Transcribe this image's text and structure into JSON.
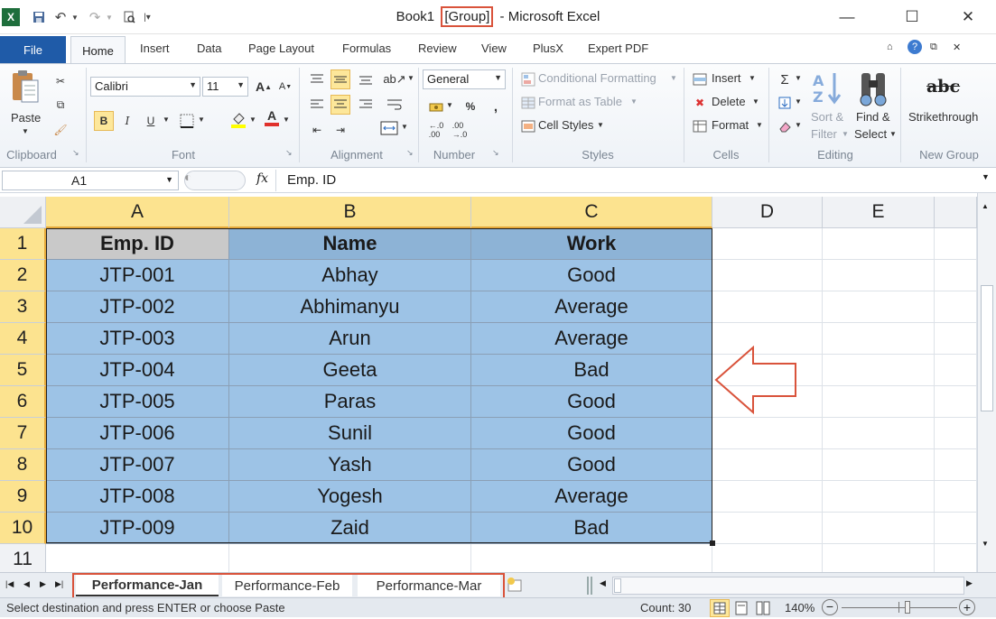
{
  "title": {
    "prefix": "Book1",
    "group": "[Group]",
    "suffix": "- Microsoft Excel"
  },
  "tabs": [
    "File",
    "Home",
    "Insert",
    "Data",
    "Page Layout",
    "Formulas",
    "Review",
    "View",
    "PlusX",
    "Expert PDF"
  ],
  "ribbon": {
    "clipboard": {
      "paste": "Paste",
      "label": "Clipboard"
    },
    "font": {
      "name": "Calibri",
      "size": "11",
      "bold": "B",
      "italic": "I",
      "underline": "U",
      "label": "Font"
    },
    "alignment": {
      "label": "Alignment"
    },
    "number": {
      "format": "General",
      "label": "Number"
    },
    "styles": {
      "conditional": "Conditional Formatting",
      "table": "Format as Table",
      "cell": "Cell Styles",
      "label": "Styles"
    },
    "cells": {
      "insert": "Insert",
      "delete": "Delete",
      "format": "Format",
      "label": "Cells"
    },
    "editing": {
      "sort1": "Sort &",
      "sort2": "Filter",
      "find1": "Find &",
      "find2": "Select",
      "label": "Editing"
    },
    "newgroup": {
      "strike_icon": "abc",
      "strike": "Strikethrough",
      "label": "New Group"
    }
  },
  "formula": {
    "namebox": "A1",
    "fx": "fx",
    "content": "Emp. ID"
  },
  "columns": [
    "A",
    "B",
    "C",
    "D",
    "E"
  ],
  "rows": [
    "1",
    "2",
    "3",
    "4",
    "5",
    "6",
    "7",
    "8",
    "9",
    "10",
    "11"
  ],
  "table": {
    "headers": [
      "Emp. ID",
      "Name",
      "Work"
    ],
    "data": [
      [
        "JTP-001",
        "Abhay",
        "Good"
      ],
      [
        "JTP-002",
        "Abhimanyu",
        "Average"
      ],
      [
        "JTP-003",
        "Arun",
        "Average"
      ],
      [
        "JTP-004",
        "Geeta",
        "Bad"
      ],
      [
        "JTP-005",
        "Paras",
        "Good"
      ],
      [
        "JTP-006",
        "Sunil",
        "Good"
      ],
      [
        "JTP-007",
        "Yash",
        "Good"
      ],
      [
        "JTP-008",
        "Yogesh",
        "Average"
      ],
      [
        "JTP-009",
        "Zaid",
        "Bad"
      ]
    ]
  },
  "sheets": [
    "Performance-Jan",
    "Performance-Feb",
    "Performance-Mar"
  ],
  "status": {
    "message": "Select destination and press ENTER or choose Paste",
    "count": "Count: 30",
    "zoom": "140%"
  },
  "colors": {
    "accent": "#d9533b",
    "selection": "#9dc3e6",
    "header_highlight": "#fce38f",
    "file_tab": "#1f5ba8"
  }
}
